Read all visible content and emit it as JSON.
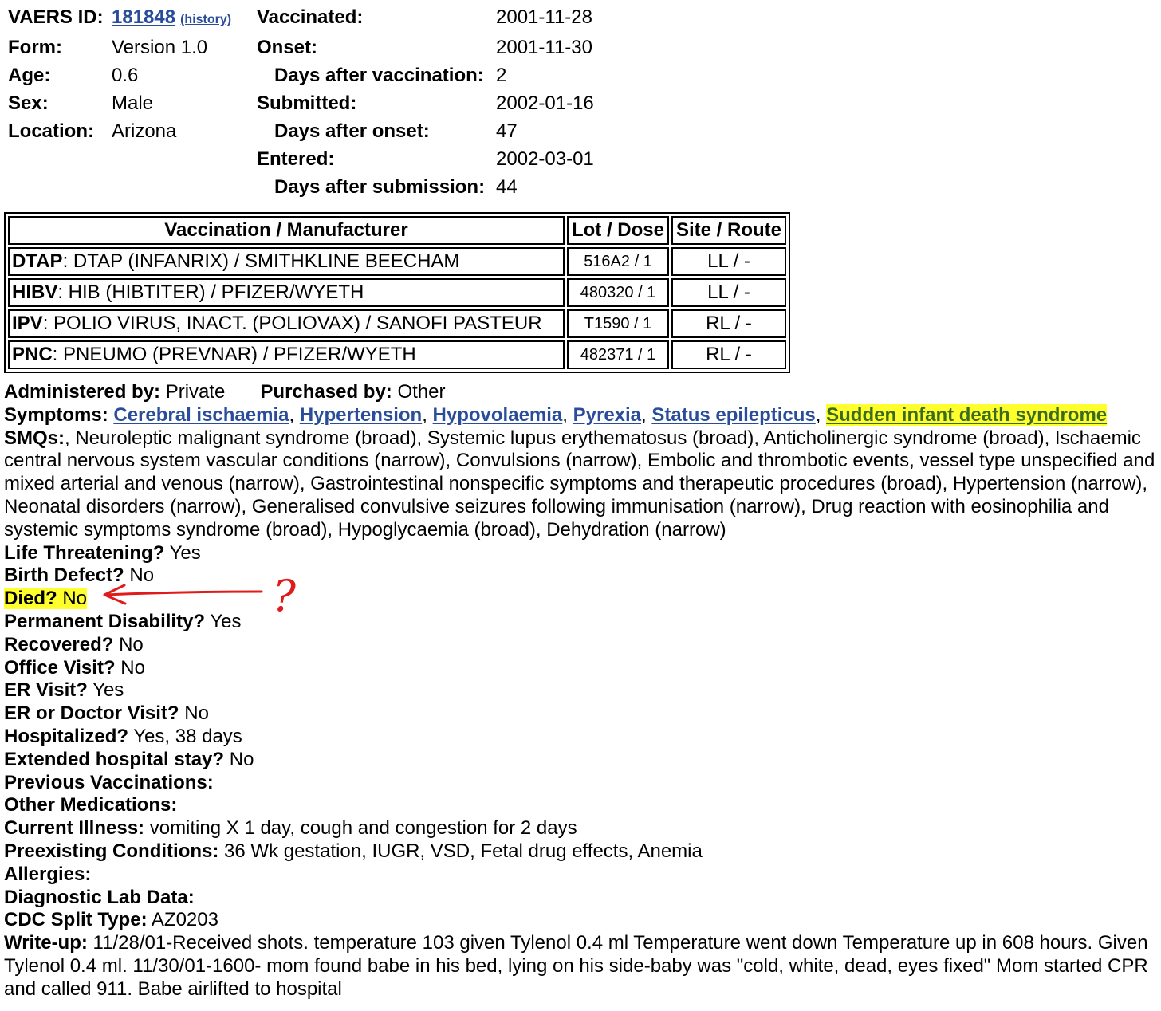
{
  "header": {
    "vaers_id_label": "VAERS ID:",
    "vaers_id": "181848",
    "history_link": "(history)",
    "form_label": "Form:",
    "form": "Version 1.0",
    "age_label": "Age:",
    "age": "0.6",
    "sex_label": "Sex:",
    "sex": "Male",
    "location_label": "Location:",
    "location": "Arizona",
    "vaccinated_label": "Vaccinated:",
    "vaccinated": "2001-11-28",
    "onset_label": "Onset:",
    "onset": "2001-11-30",
    "days_after_vax_label": "Days after vaccination:",
    "days_after_vax": "2",
    "submitted_label": "Submitted:",
    "submitted": "2002-01-16",
    "days_after_onset_label": "Days after onset:",
    "days_after_onset": "47",
    "entered_label": "Entered:",
    "entered": "2002-03-01",
    "days_after_submission_label": "Days after submission:",
    "days_after_submission": "44"
  },
  "vax_table": {
    "headers": [
      "Vaccination / Manufacturer",
      "Lot / Dose",
      "Site / Route"
    ],
    "rows": [
      {
        "code": "DTAP",
        "name": ": DTAP (INFANRIX) / SMITHKLINE BEECHAM",
        "lot": "516A2 / 1",
        "site": "LL / -"
      },
      {
        "code": "HIBV",
        "name": ": HIB (HIBTITER) / PFIZER/WYETH",
        "lot": "480320 / 1",
        "site": "LL / -"
      },
      {
        "code": "IPV",
        "name": ": POLIO VIRUS, INACT. (POLIOVAX) / SANOFI PASTEUR",
        "lot": "T1590 / 1",
        "site": "RL / -"
      },
      {
        "code": "PNC",
        "name": ": PNEUMO (PREVNAR) / PFIZER/WYETH",
        "lot": "482371 / 1",
        "site": "RL / -"
      }
    ]
  },
  "details": {
    "administered_label": "Administered by:",
    "administered": "Private",
    "purchased_label": "Purchased by:",
    "purchased": "Other",
    "symptoms_label": "Symptoms:",
    "symptoms": [
      "Cerebral ischaemia",
      "Hypertension",
      "Hypovolaemia",
      "Pyrexia",
      "Status epilepticus",
      "Sudden infant death syndrome"
    ],
    "symptom_sep": ", ",
    "smqs_label": "SMQs:",
    "smqs": ", Neuroleptic malignant syndrome (broad), Systemic lupus erythematosus (broad), Anticholinergic syndrome (broad), Ischaemic central nervous system vascular conditions (narrow), Convulsions (narrow), Embolic and thrombotic events, vessel type unspecified and mixed arterial and venous (narrow), Gastrointestinal nonspecific symptoms and therapeutic procedures (broad), Hypertension (narrow), Neonatal disorders (narrow), Generalised convulsive seizures following immunisation (narrow), Drug reaction with eosinophilia and systemic symptoms syndrome (broad), Hypoglycaemia (broad), Dehydration (narrow)",
    "life_threatening_label": "Life Threatening?",
    "life_threatening": "Yes",
    "birth_defect_label": "Birth Defect?",
    "birth_defect": "No",
    "died_label": "Died?",
    "died": "No",
    "perm_disability_label": "Permanent Disability?",
    "perm_disability": "Yes",
    "recovered_label": "Recovered?",
    "recovered": "No",
    "office_visit_label": "Office Visit?",
    "office_visit": "No",
    "er_visit_label": "ER Visit?",
    "er_visit": "Yes",
    "er_doctor_label": "ER or Doctor Visit?",
    "er_doctor": "No",
    "hospitalized_label": "Hospitalized?",
    "hospitalized": "Yes, 38 days",
    "extended_stay_label": "Extended hospital stay?",
    "extended_stay": "No",
    "prev_vax_label": "Previous Vaccinations:",
    "prev_vax": "",
    "other_meds_label": "Other Medications:",
    "other_meds": "",
    "current_illness_label": "Current Illness:",
    "current_illness": "vomiting X 1 day, cough and congestion for 2 days",
    "preexisting_label": "Preexisting Conditions:",
    "preexisting": "36 Wk gestation, IUGR, VSD, Fetal drug effects, Anemia",
    "allergies_label": "Allergies:",
    "allergies": "",
    "lab_label": "Diagnostic Lab Data:",
    "lab": "",
    "cdc_split_label": "CDC Split Type:",
    "cdc_split": "AZ0203",
    "writeup_label": "Write-up:",
    "writeup": "11/28/01-Received shots. temperature 103 given Tylenol 0.4 ml Temperature went down Temperature up in 608 hours. Given Tylenol 0.4 ml. 11/30/01-1600- mom found babe in his bed, lying on his side-baby was \"cold, white, dead, eyes fixed\" Mom started CPR and called 911. Babe airlifted to hospital"
  },
  "annotation": {
    "mark": "?",
    "color": "#e01b1b"
  },
  "colors": {
    "highlight": "#ffff2e",
    "link": "#2a4d9b"
  }
}
